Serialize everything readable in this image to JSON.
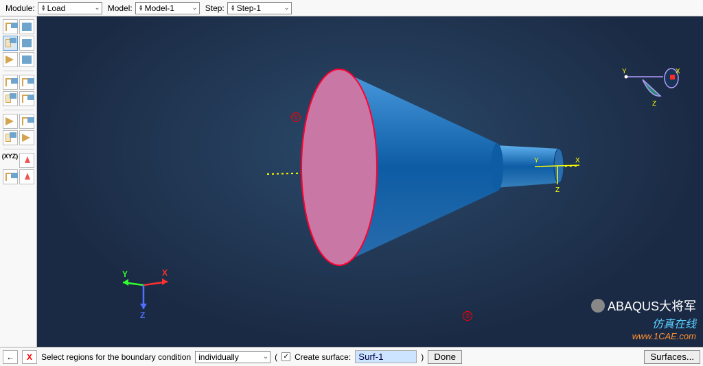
{
  "toolbar": {
    "module_label": "Module:",
    "module_value": "Load",
    "model_label": "Model:",
    "model_value": "Model-1",
    "step_label": "Step:",
    "step_value": "Step-1"
  },
  "tools": {
    "xyz_label": "(XYZ)"
  },
  "viewport": {
    "watermark": "1CAE.COM",
    "annotation_1": "①",
    "annotation_2": "②",
    "triad_x": "X",
    "triad_y": "Y",
    "triad_z": "Z",
    "nav_x": "X",
    "nav_y": "Y",
    "nav_z": "Z",
    "brand_line1": "ABAQUS大将军",
    "brand_line2": "仿真在线",
    "brand_line3": "www.1CAE.com"
  },
  "bottom": {
    "prompt_text": "Select regions for the boundary condition",
    "mode": "individually",
    "create_surface_label": "Create surface:",
    "create_surface_checked": "✓",
    "surface_name": "Surf-1",
    "done_label": "Done",
    "surfaces_label": "Surfaces...",
    "paren_open": "(",
    "paren_close": ")"
  }
}
